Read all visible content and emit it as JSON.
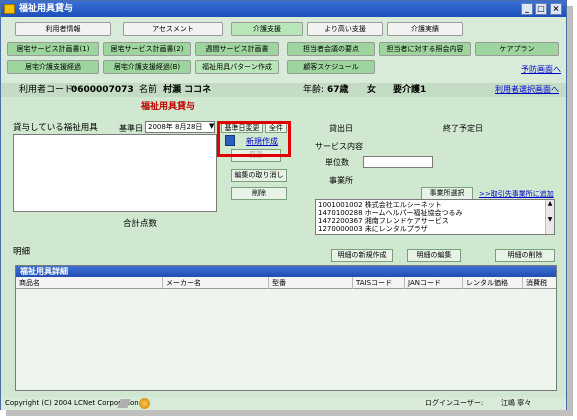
{
  "window": {
    "title": "福祉用具貸与"
  },
  "titlebar_buttons": [
    "_",
    "□",
    "×"
  ],
  "menu": {
    "row1": [
      "利用者情報",
      "アセスメント",
      "介護支援",
      "より高い支援",
      "介護実績"
    ],
    "row2": [
      "居宅サービス計画書(1)",
      "居宅サービス計画書(2)",
      "週間サービス計画書",
      "担当者会議の要点",
      "担当者に対する照会内容",
      "ケアプラン"
    ],
    "row3": [
      "居宅介護支援経過",
      "居宅介護支援経過(B)",
      "福祉用具パターン作成",
      "顧客スケジュール"
    ],
    "prevention_link": "予防画面へ"
  },
  "info": {
    "user_code_label": "利用者コード:",
    "user_code": "0600007073",
    "name_label": "名前",
    "name": "村瀬 ココネ",
    "age_label": "年齢:",
    "age": "67歳",
    "gender": "女",
    "care_level": "要介護1",
    "select_user_link": "利用者選択画面へ"
  },
  "section_title": "福祉用具貸与",
  "left": {
    "rented_label": "貸与している福祉用具",
    "base_date_label": "基準日",
    "base_date": "2008年 8月28日",
    "base_date_change": "基準日変更",
    "all_button": "全件",
    "new_create": "新規作成",
    "change_button": "変更",
    "cancel_edit_button": "編集の取り消し",
    "delete_button": "削除",
    "total_points_label": "合計点数"
  },
  "right": {
    "rental_date_label": "貸出日",
    "end_date_label": "終了予定日",
    "service_content_label": "サービス内容",
    "units_label": "単位数",
    "office_label": "事業所",
    "office_select_button": "事業所選択",
    "add_office_link": ">>取引先事業所に追加",
    "offices": [
      "1001001002  株式会社エルシーネット",
      "1470100288  ホームヘルパー福祉協会つるみ",
      "1472200367  湘南フレンドケアサービス",
      "1270000003  未にレンタルプラザ"
    ]
  },
  "detail": {
    "label": "明細",
    "new_button": "明細の新規作成",
    "edit_button": "明細の編集",
    "delete_button": "明細の削除",
    "grid_title": "福祉用具詳細",
    "columns": [
      "商品名",
      "メーカー名",
      "型番",
      "TAISコード",
      "JANコード",
      "レンタル価格",
      "消費税"
    ]
  },
  "status": {
    "copyright": "Copyright (C) 2004 LCNet Corporation",
    "login_user_label": "ログインユーザー:",
    "login_user": "江嶋 寧々"
  },
  "colors": {
    "window_bg": "#cfe8cf",
    "title_blue": "#1c4fb8",
    "accent_red": "#c00000",
    "highlight_red": "#e00000",
    "link_blue": "#0000cc"
  }
}
